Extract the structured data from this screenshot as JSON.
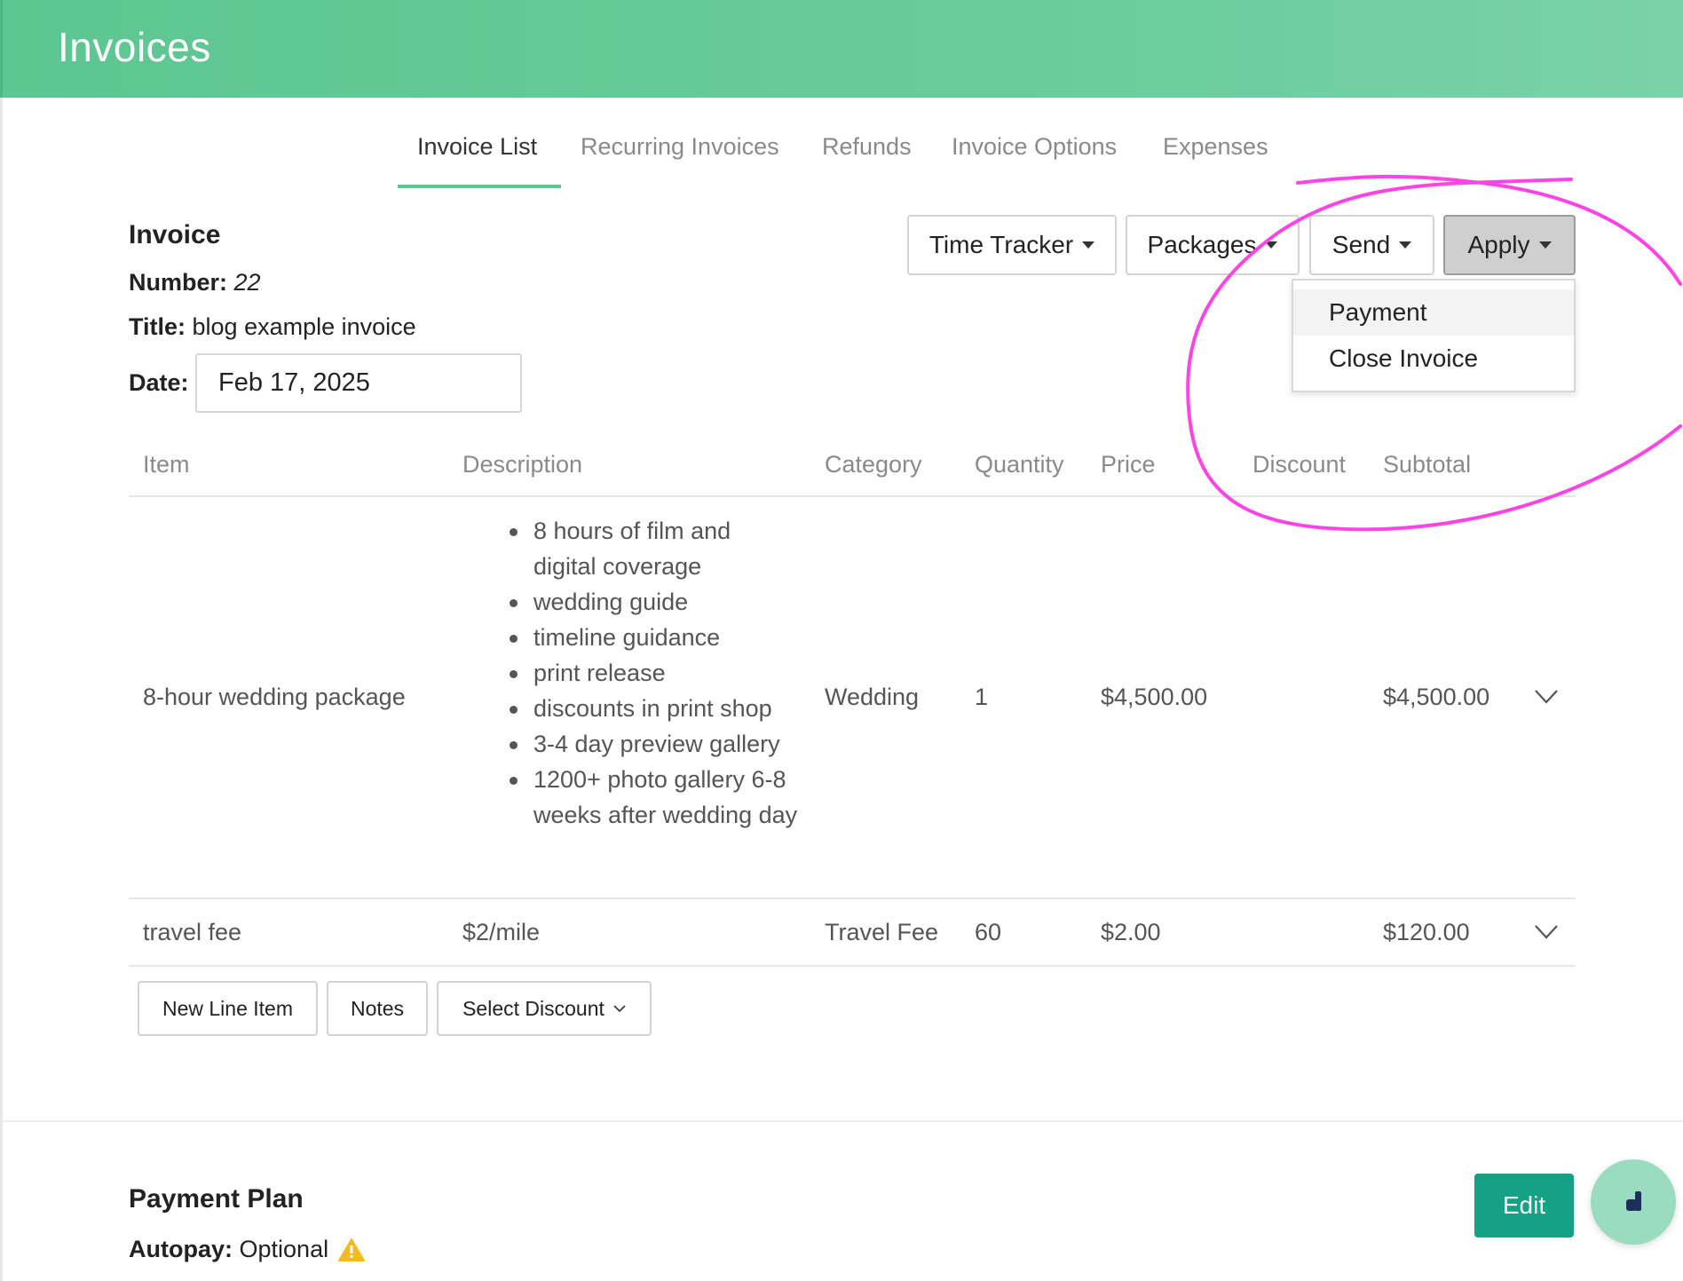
{
  "header": {
    "title": "Invoices"
  },
  "tabs": [
    {
      "label": "Invoice List",
      "active": true
    },
    {
      "label": "Recurring Invoices"
    },
    {
      "label": "Refunds"
    },
    {
      "label": "Invoice Options"
    },
    {
      "label": "Expenses"
    }
  ],
  "invoice": {
    "heading": "Invoice",
    "number_label": "Number:",
    "number": "22",
    "title_label": "Title:",
    "title": "blog example invoice",
    "date_label": "Date:",
    "date": "Feb 17, 2025"
  },
  "toolbar": {
    "time_tracker": "Time Tracker",
    "packages": "Packages",
    "send": "Send",
    "apply": "Apply"
  },
  "apply_menu": {
    "items": [
      "Payment",
      "Close Invoice"
    ]
  },
  "table": {
    "columns": [
      "Item",
      "Description",
      "Category",
      "Quantity",
      "Price",
      "Discount",
      "Subtotal"
    ],
    "rows": [
      {
        "item": "8-hour wedding package",
        "description": [
          "8 hours of film and digital coverage",
          "wedding guide",
          "timeline guidance",
          "print release",
          "discounts in print shop",
          "3-4 day preview gallery",
          "1200+ photo gallery 6-8 weeks after wedding day"
        ],
        "category": "Wedding",
        "quantity": "1",
        "price": "$4,500.00",
        "discount": "",
        "subtotal": "$4,500.00"
      },
      {
        "item": "travel fee",
        "description": "$2/mile",
        "category": "Travel Fee",
        "quantity": "60",
        "price": "$2.00",
        "discount": "",
        "subtotal": "$120.00"
      }
    ]
  },
  "actions": {
    "new_line_item": "New Line Item",
    "notes": "Notes",
    "select_discount": "Select Discount"
  },
  "payment_plan": {
    "heading": "Payment Plan",
    "autopay_label": "Autopay:",
    "autopay_value": "Optional",
    "edit": "Edit"
  },
  "colors": {
    "header": "#5dc691",
    "accent": "#13a384",
    "annotation": "#ff44e6",
    "warning": "#f5b921"
  },
  "icons": [
    "caret-down-icon",
    "chevron-down-icon",
    "warning-icon",
    "chat-icon"
  ]
}
